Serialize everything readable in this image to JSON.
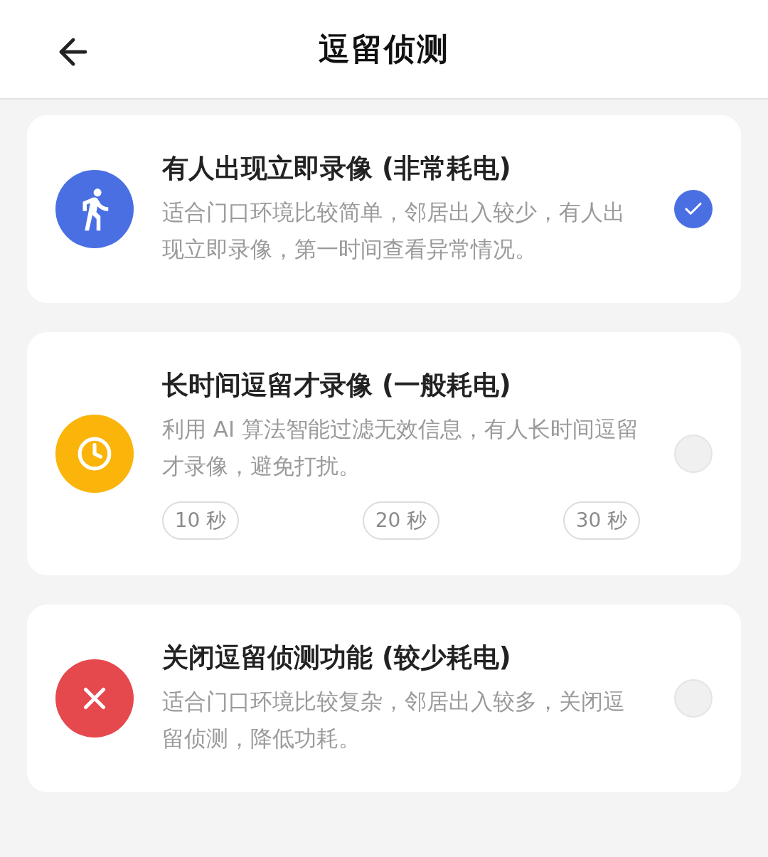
{
  "header": {
    "title": "逗留侦测"
  },
  "options": [
    {
      "kind": "walk",
      "color": "#4a6fe3",
      "title": "有人出现立即录像 (非常耗电)",
      "description": "适合门口环境比较简单，邻居出入较少，有人出现立即录像，第一时间查看异常情况。",
      "selected": true
    },
    {
      "kind": "clock",
      "color": "#fbb40a",
      "title": "长时间逗留才录像 (一般耗电)",
      "description": "利用 AI 算法智能过滤无效信息，有人长时间逗留才录像，避免打扰。",
      "selected": false,
      "durations": [
        "10 秒",
        "20 秒",
        "30 秒"
      ]
    },
    {
      "kind": "off",
      "color": "#e5484d",
      "title": "关闭逗留侦测功能 (较少耗电)",
      "description": "适合门口环境比较复杂，邻居出入较多，关闭逗留侦测，降低功耗。",
      "selected": false
    }
  ]
}
